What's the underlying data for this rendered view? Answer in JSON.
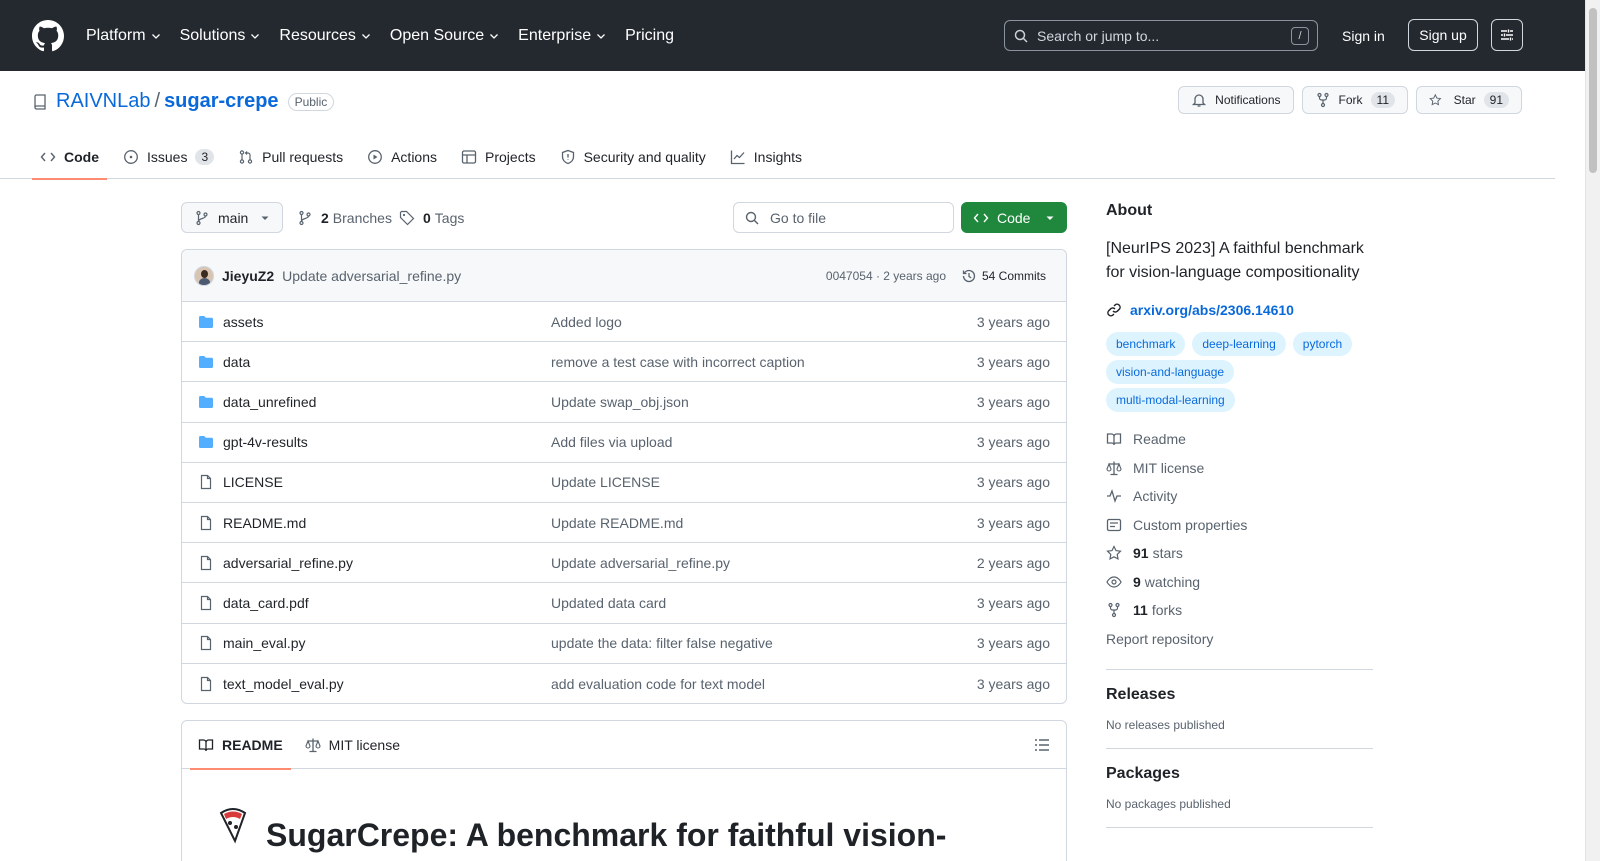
{
  "header": {
    "nav": [
      "Platform",
      "Solutions",
      "Resources",
      "Open Source",
      "Enterprise",
      "Pricing"
    ],
    "search_placeholder": "Search or jump to...",
    "search_key": "/",
    "sign_in": "Sign in",
    "sign_up": "Sign up"
  },
  "repo": {
    "owner": "RAIVNLab",
    "separator": "/",
    "name": "sugar-crepe",
    "visibility": "Public",
    "notifications_label": "Notifications",
    "fork_label": "Fork",
    "fork_count": "11",
    "star_label": "Star",
    "star_count": "91"
  },
  "tabs": [
    {
      "label": "Code",
      "icon": "code-icon"
    },
    {
      "label": "Issues",
      "icon": "issue-icon",
      "count": "3"
    },
    {
      "label": "Pull requests",
      "icon": "pull-request-icon"
    },
    {
      "label": "Actions",
      "icon": "play-icon"
    },
    {
      "label": "Projects",
      "icon": "table-icon"
    },
    {
      "label": "Security and quality",
      "icon": "shield-icon"
    },
    {
      "label": "Insights",
      "icon": "graph-icon"
    }
  ],
  "toolbar": {
    "branch": "main",
    "branches_count": "2",
    "branches_label": "Branches",
    "tags_count": "0",
    "tags_label": "Tags",
    "go_to_file": "Go to file",
    "code_button": "Code"
  },
  "commit": {
    "author": "JieyuZ2",
    "message": "Update adversarial_refine.py",
    "meta": "0047054 · 2 years ago",
    "count_label": "54 Commits"
  },
  "files": [
    {
      "name": "assets",
      "type": "folder",
      "message": "Added logo",
      "date": "3 years ago"
    },
    {
      "name": "data",
      "type": "folder",
      "message": "remove a test case with incorrect caption",
      "date": "3 years ago"
    },
    {
      "name": "data_unrefined",
      "type": "folder",
      "message": "Update swap_obj.json",
      "date": "3 years ago"
    },
    {
      "name": "gpt-4v-results",
      "type": "folder",
      "message": "Add files via upload",
      "date": "3 years ago"
    },
    {
      "name": "LICENSE",
      "type": "file",
      "message": "Update LICENSE",
      "date": "3 years ago"
    },
    {
      "name": "README.md",
      "type": "file",
      "message": "Update README.md",
      "date": "3 years ago"
    },
    {
      "name": "adversarial_refine.py",
      "type": "file",
      "message": "Update adversarial_refine.py",
      "date": "2 years ago"
    },
    {
      "name": "data_card.pdf",
      "type": "file",
      "message": "Updated data card",
      "date": "3 years ago"
    },
    {
      "name": "main_eval.py",
      "type": "file",
      "message": "update the data: filter false negative",
      "date": "3 years ago"
    },
    {
      "name": "text_model_eval.py",
      "type": "file",
      "message": "add evaluation code for text model",
      "date": "3 years ago"
    }
  ],
  "readme": {
    "tab_readme": "README",
    "tab_license": "MIT license",
    "heading": "SugarCrepe: A benchmark for faithful vision-"
  },
  "about": {
    "title": "About",
    "description": "[NeurIPS 2023] A faithful benchmark for vision-language compositionality",
    "link": "arxiv.org/abs/2306.14610",
    "topics": [
      "benchmark",
      "deep-learning",
      "pytorch",
      "vision-and-language",
      "multi-modal-learning"
    ],
    "readme": "Readme",
    "license": "MIT license",
    "activity": "Activity",
    "custom_properties": "Custom properties",
    "stars_count": "91",
    "stars_label": "stars",
    "watching_count": "9",
    "watching_label": "watching",
    "forks_count": "11",
    "forks_label": "forks",
    "report": "Report repository"
  },
  "releases": {
    "title": "Releases",
    "text": "No releases published"
  },
  "packages": {
    "title": "Packages",
    "text": "No packages published"
  },
  "colors": {
    "accent": "#0969da",
    "header_bg": "#24292f",
    "code_button": "#1f883d",
    "tab_underline": "#fd8c73",
    "folder": "#54aeff"
  }
}
